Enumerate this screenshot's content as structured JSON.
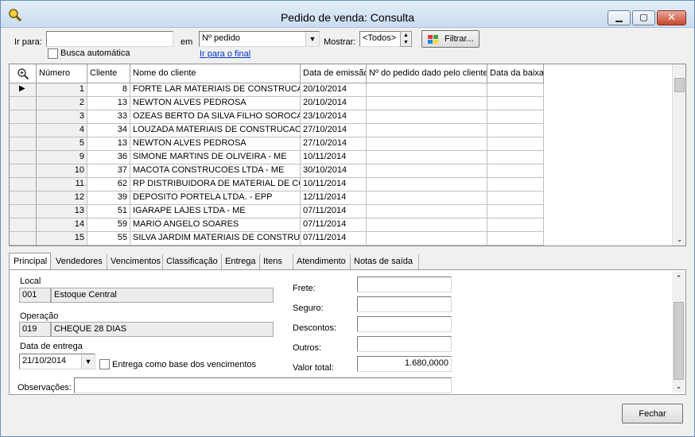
{
  "window": {
    "title": "Pedido de venda: Consulta"
  },
  "toolbar": {
    "ir_para_label": "Ir para:",
    "ir_para_value": "",
    "em_label": "em",
    "em_value": "Nº pedido",
    "busca_automatica_label": "Busca automática",
    "ir_para_final": "Ir para o final",
    "mostrar_label": "Mostrar:",
    "mostrar_value": "<Todos>",
    "filtrar_label": "Filtrar..."
  },
  "grid": {
    "columns": [
      "Número",
      "Cliente",
      "Nome do cliente",
      "Data de emissão",
      "Nº do pedido dado pelo cliente",
      "Data da baixa"
    ],
    "rows": [
      {
        "numero": "1",
        "cliente": "8",
        "nome": "FORTE LAR MATERIAIS DE CONSTRUCAO",
        "emissao": "20/10/2014"
      },
      {
        "numero": "2",
        "cliente": "13",
        "nome": "NEWTON ALVES PEDROSA",
        "emissao": "20/10/2014"
      },
      {
        "numero": "3",
        "cliente": "33",
        "nome": "OZEAS BERTO DA SILVA FILHO SOROCABA",
        "emissao": "23/10/2014"
      },
      {
        "numero": "4",
        "cliente": "34",
        "nome": "LOUZADA MATERIAIS DE CONSTRUCAO",
        "emissao": "27/10/2014"
      },
      {
        "numero": "5",
        "cliente": "13",
        "nome": "NEWTON ALVES PEDROSA",
        "emissao": "27/10/2014"
      },
      {
        "numero": "9",
        "cliente": "36",
        "nome": "SIMONE MARTINS DE OLIVEIRA - ME",
        "emissao": "10/11/2014"
      },
      {
        "numero": "10",
        "cliente": "37",
        "nome": "MACOTA CONSTRUCOES LTDA - ME",
        "emissao": "30/10/2014"
      },
      {
        "numero": "11",
        "cliente": "62",
        "nome": "RP DISTRIBUIDORA DE MATERIAL DE CONSTRUCAO",
        "emissao": "10/11/2014"
      },
      {
        "numero": "12",
        "cliente": "39",
        "nome": "DEPOSITO PORTELA LTDA. - EPP",
        "emissao": "12/11/2014"
      },
      {
        "numero": "13",
        "cliente": "51",
        "nome": "IGARAPE LAJES LTDA - ME",
        "emissao": "07/11/2014"
      },
      {
        "numero": "14",
        "cliente": "59",
        "nome": "MARIO ANGELO SOARES",
        "emissao": "07/11/2014"
      },
      {
        "numero": "15",
        "cliente": "55",
        "nome": "SILVA JARDIM MATERIAIS DE CONSTRUCAO",
        "emissao": "07/11/2014"
      }
    ]
  },
  "tabs": [
    "Principal",
    "Vendedores",
    "Vencimentos",
    "Classificação",
    "Entrega",
    "Itens",
    "Atendimento",
    "Notas de saída"
  ],
  "principal": {
    "local_label": "Local",
    "local_code": "001",
    "local_name": "Estoque Central",
    "operacao_label": "Operação",
    "operacao_code": "019",
    "operacao_name": "CHEQUE 28 DIAS",
    "data_entrega_label": "Data de entrega",
    "data_entrega_value": "21/10/2014",
    "entrega_base_label": "Entrega como base dos vencimentos",
    "frete_label": "Frete:",
    "frete_value": "",
    "seguro_label": "Seguro:",
    "seguro_value": "",
    "descontos_label": "Descontos:",
    "descontos_value": "",
    "outros_label": "Outros:",
    "outros_value": "",
    "valor_total_label": "Valor total:",
    "valor_total_value": "1.680,0000",
    "observacoes_label": "Observações:",
    "observacoes_value": ""
  },
  "footer": {
    "fechar_label": "Fechar"
  }
}
